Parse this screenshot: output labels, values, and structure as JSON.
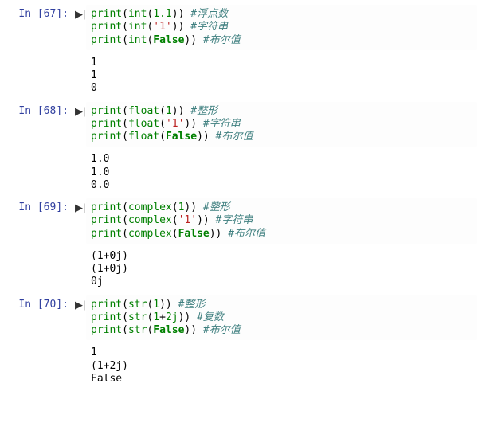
{
  "cells": [
    {
      "prompt": "In [67]:",
      "run_icon": "▶|",
      "code": {
        "l1": {
          "fn": "print",
          "op1": "(",
          "cast": "int",
          "op2": "(",
          "arg": "1.1",
          "op3": "))",
          "cmt": " #浮点数"
        },
        "l2": {
          "fn": "print",
          "op1": "(",
          "cast": "int",
          "op2": "(",
          "arg": "'1'",
          "op3": "))",
          "cmt": " #字符串"
        },
        "l3": {
          "fn": "print",
          "op1": "(",
          "cast": "int",
          "op2": "(",
          "arg": "False",
          "op3": "))",
          "cmt": " #布尔值"
        }
      },
      "out1": "1",
      "out2": "1",
      "out3": "0"
    },
    {
      "prompt": "In [68]:",
      "run_icon": "▶|",
      "code": {
        "l1": {
          "fn": "print",
          "op1": "(",
          "cast": "float",
          "op2": "(",
          "arg": "1",
          "op3": "))",
          "cmt": " #整形"
        },
        "l2": {
          "fn": "print",
          "op1": "(",
          "cast": "float",
          "op2": "(",
          "arg": "'1'",
          "op3": "))",
          "cmt": " #字符串"
        },
        "l3": {
          "fn": "print",
          "op1": "(",
          "cast": "float",
          "op2": "(",
          "arg": "False",
          "op3": "))",
          "cmt": " #布尔值"
        }
      },
      "out1": "1.0",
      "out2": "1.0",
      "out3": "0.0"
    },
    {
      "prompt": "In [69]:",
      "run_icon": "▶|",
      "code": {
        "l1": {
          "fn": "print",
          "op1": "(",
          "cast": "complex",
          "op2": "(",
          "arg": "1",
          "op3": "))",
          "cmt": " #整形"
        },
        "l2": {
          "fn": "print",
          "op1": "(",
          "cast": "complex",
          "op2": "(",
          "arg": "'1'",
          "op3": "))",
          "cmt": " #字符串"
        },
        "l3": {
          "fn": "print",
          "op1": "(",
          "cast": "complex",
          "op2": "(",
          "arg": "False",
          "op3": "))",
          "cmt": " #布尔值"
        }
      },
      "out1": "(1+0j)",
      "out2": "(1+0j)",
      "out3": "0j"
    },
    {
      "prompt": "In [70]:",
      "run_icon": "▶|",
      "code": {
        "l1": {
          "fn": "print",
          "op1": "(",
          "cast": "str",
          "op2": "(",
          "arg": "1",
          "op3": "))",
          "cmt": " #整形"
        },
        "l2": {
          "fn": "print",
          "op1": "(",
          "cast": "str",
          "op2": "(",
          "d_arg1": "1",
          "d_op": "+",
          "d_arg2": "2j",
          "op3": "))",
          "cmt": " #复数"
        },
        "l3": {
          "fn": "print",
          "op1": "(",
          "cast": "str",
          "op2": "(",
          "arg": "False",
          "op3": "))",
          "cmt": " #布尔值"
        }
      },
      "out1": "1",
      "out2": "(1+2j)",
      "out3": "False"
    }
  ]
}
